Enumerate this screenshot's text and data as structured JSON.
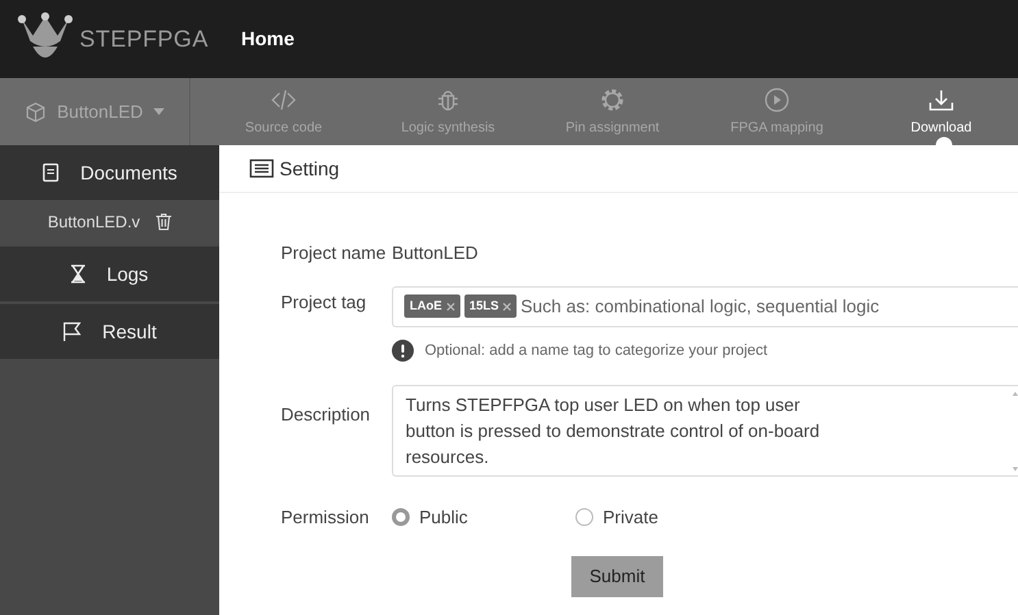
{
  "header": {
    "logo_text": "STEPFPGA",
    "title": "Home"
  },
  "project_menu": {
    "label": "ButtonLED"
  },
  "toolbar": [
    {
      "label": "Source code",
      "kind": "code",
      "selected": false
    },
    {
      "label": "Logic synthesis",
      "kind": "bug",
      "selected": false
    },
    {
      "label": "Pin assignment",
      "kind": "gear",
      "selected": false
    },
    {
      "label": "FPGA mapping",
      "kind": "play",
      "selected": false
    },
    {
      "label": "Download",
      "kind": "download",
      "selected": true
    }
  ],
  "sidebar": [
    {
      "label": "Documents",
      "kind": "doc",
      "children": [
        {
          "label": "ButtonLED.v"
        }
      ]
    },
    {
      "label": "Logs",
      "kind": "hourglass"
    },
    {
      "label": "Result",
      "kind": "flag"
    }
  ],
  "panel": {
    "title": "Setting"
  },
  "form": {
    "name_label": "Project name",
    "name_value": "ButtonLED",
    "tag_label": "Project tag",
    "tags": [
      "LAoE",
      "15LS"
    ],
    "tag_placeholder": "Such as: combinational logic, sequential logic",
    "tag_hint": "Optional: add a name tag to categorize your project",
    "description_label": "Description",
    "description": "Turns STEPFPGA top user LED on when top user\nbutton is pressed to demonstrate control of on-board\nresources.",
    "permission_label": "Permission",
    "permissions": [
      {
        "label": "Public",
        "selected": true
      },
      {
        "label": "Private",
        "selected": false
      }
    ],
    "submit": "Submit"
  }
}
